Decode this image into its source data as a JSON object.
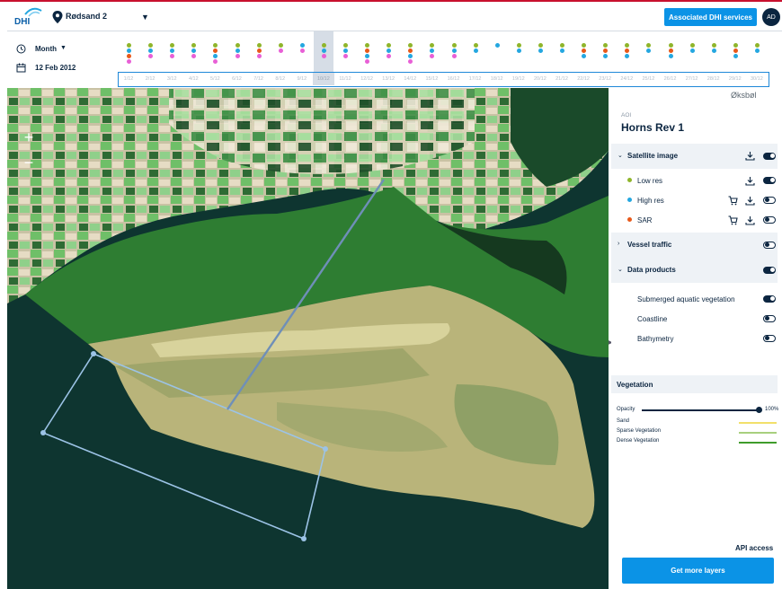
{
  "header": {
    "logo_text": "DHI",
    "location": "Rødsand 2",
    "assoc_button": "Associated DHI services",
    "avatar_initials": "AD"
  },
  "timeline": {
    "period": "Month",
    "date": "12 Feb 2012",
    "selected_day": "10/12",
    "days": [
      "1/12",
      "2/12",
      "3/12",
      "4/12",
      "5/12",
      "6/12",
      "7/12",
      "8/12",
      "9/12",
      "10/12",
      "11/12",
      "12/12",
      "13/12",
      "14/12",
      "15/12",
      "16/12",
      "17/12",
      "18/12",
      "19/12",
      "20/12",
      "21/12",
      "22/12",
      "23/12",
      "24/12",
      "25/12",
      "26/12",
      "27/12",
      "28/12",
      "29/12",
      "30/12"
    ],
    "dot_colors": {
      "low": "#8fb52b",
      "high": "#24a7e0",
      "sar": "#e8591a",
      "pink": "#e85fd6"
    },
    "dot_rows": [
      [
        "low",
        "high",
        "sar",
        "pink"
      ],
      [
        "low",
        "high",
        "pink"
      ],
      [
        "low",
        "high",
        "pink"
      ],
      [
        "low",
        "high",
        "pink"
      ],
      [
        "low",
        "sar",
        "high",
        "pink"
      ],
      [
        "low",
        "high",
        "pink"
      ],
      [
        "low",
        "sar",
        "pink"
      ],
      [
        "low",
        "pink"
      ],
      [
        "high",
        "pink"
      ],
      [
        "low",
        "high",
        "pink"
      ],
      [
        "low",
        "high",
        "pink"
      ],
      [
        "low",
        "sar",
        "high",
        "pink"
      ],
      [
        "low",
        "high",
        "pink"
      ],
      [
        "low",
        "sar",
        "high",
        "pink"
      ],
      [
        "low",
        "high",
        "pink"
      ],
      [
        "low",
        "high",
        "pink"
      ],
      [
        "low",
        "high"
      ],
      [
        "high"
      ],
      [
        "low",
        "high"
      ],
      [
        "low",
        "high"
      ],
      [
        "low",
        "high"
      ],
      [
        "low",
        "sar",
        "high"
      ],
      [
        "low",
        "sar",
        "high"
      ],
      [
        "low",
        "sar",
        "high"
      ],
      [
        "low",
        "high"
      ],
      [
        "low",
        "sar",
        "high"
      ],
      [
        "low",
        "high"
      ],
      [
        "low",
        "high"
      ],
      [
        "low",
        "sar",
        "high"
      ],
      [
        "low",
        "high"
      ]
    ]
  },
  "map": {
    "place_label": "Øksbøl",
    "zoom_in": "+",
    "zoom_out": "−"
  },
  "panel": {
    "aoi_label": "AOI",
    "aoi_title": "Horns Rev 1",
    "satellite": {
      "label": "Satellite image",
      "on": true
    },
    "layers": [
      {
        "label": "Low res",
        "color": "#8fb52b",
        "on": true
      },
      {
        "label": "High res",
        "color": "#24a7e0",
        "on": false
      },
      {
        "label": "SAR",
        "color": "#e8591a",
        "on": false
      }
    ],
    "vessel": {
      "label": "Vessel traffic",
      "on": false
    },
    "data_products": {
      "label": "Data products",
      "on": true
    },
    "products": [
      {
        "label": "Submerged aquatic vegetation",
        "on": true
      },
      {
        "label": "Coastline",
        "on": false
      },
      {
        "label": "Bathymetry",
        "on": false
      }
    ],
    "vegetation": {
      "title": "Vegetation",
      "opacity_label": "Opacity",
      "opacity_value": "100%",
      "opacity_fraction": 1.0,
      "legend": [
        {
          "label": "Sand",
          "color": "#f2e06a"
        },
        {
          "label": "Sparse Vegetation",
          "color": "#a8cf7e"
        },
        {
          "label": "Dense Vegetation",
          "color": "#3f9c2b"
        }
      ]
    },
    "api_label": "API access",
    "more_button": "Get more layers"
  }
}
